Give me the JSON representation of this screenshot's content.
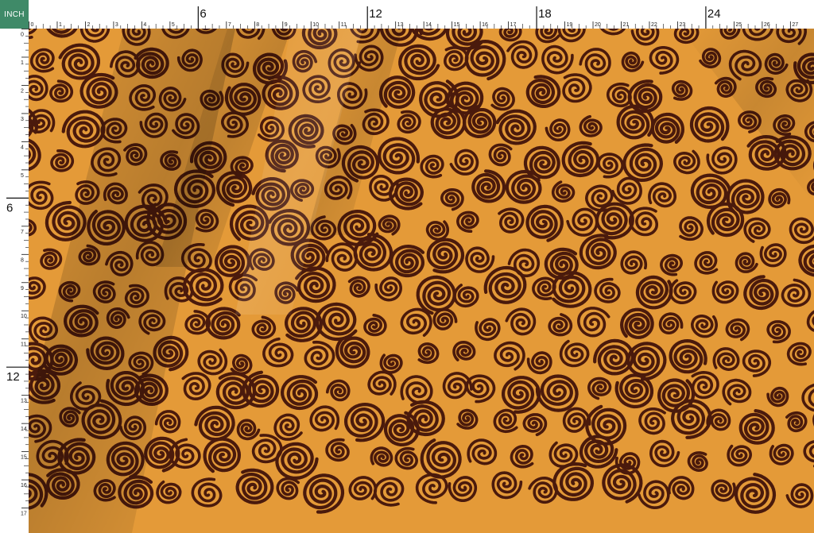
{
  "unit_label": "INCH",
  "ruler": {
    "top_start": 0,
    "top_end": 27,
    "left_start": 0,
    "left_end": 17,
    "major_every": 6,
    "major_labels_top": [
      "6",
      "12",
      "18",
      "24"
    ],
    "major_labels_left": [
      "6",
      "12"
    ]
  },
  "fabric": {
    "pattern": "hand-drawn spiral swirls",
    "background_color": "#e49a38",
    "motif_color": "#4a1a0c"
  },
  "colors": {
    "unit_badge": "#3f8a68",
    "ruler_bg": "#ffffff",
    "ruler_ink": "#111111"
  }
}
